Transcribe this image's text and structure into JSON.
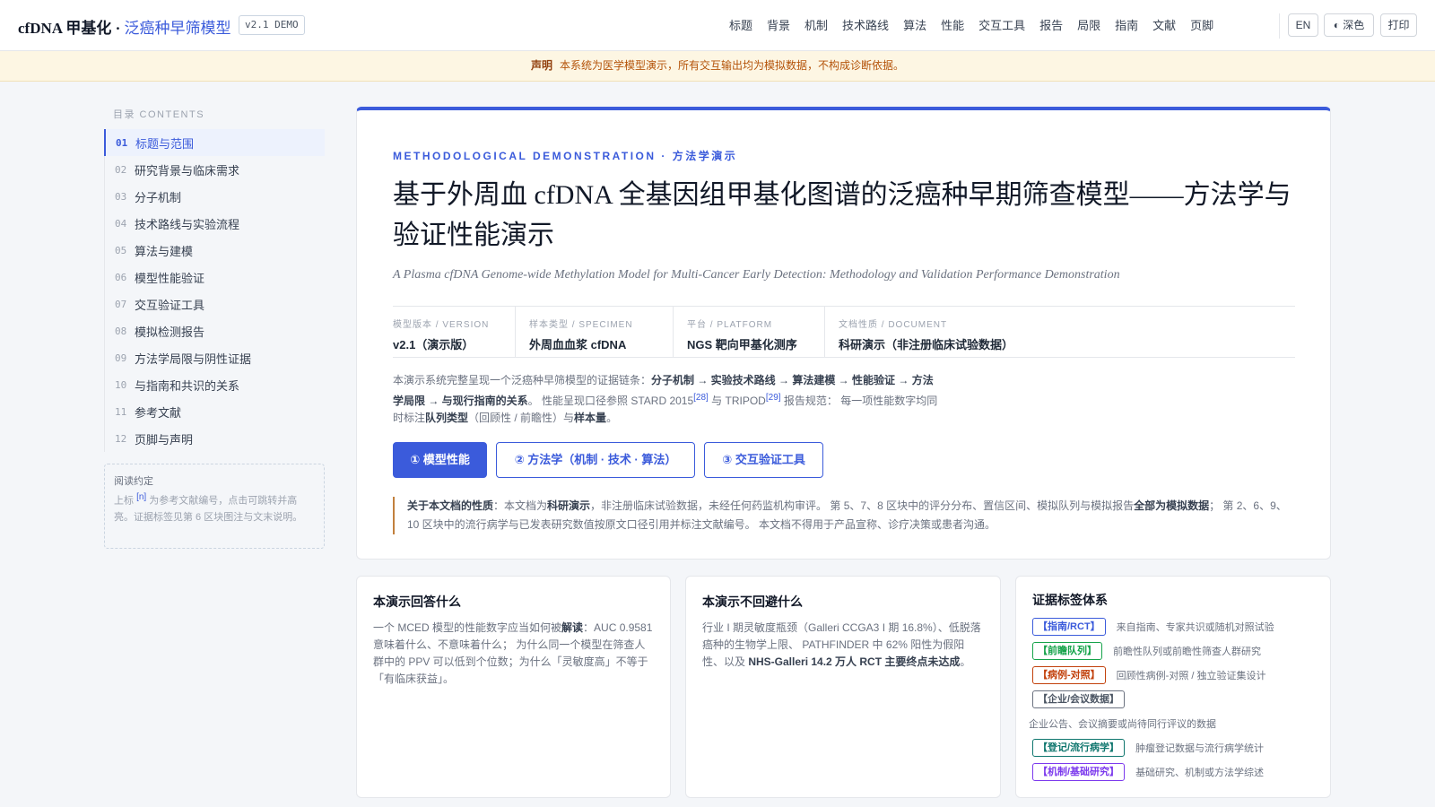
{
  "header": {
    "brand_main": "cfDNA 甲基化 · ",
    "brand_accent": "泛癌种早筛模型",
    "version_badge": "v2.1 DEMO",
    "nav": [
      "标题",
      "背景",
      "机制",
      "技术路线",
      "算法",
      "性能",
      "交互工具",
      "报告",
      "局限",
      "指南",
      "文献",
      "页脚"
    ],
    "lang_button": "EN",
    "theme_button": "深色",
    "print_button": "打印"
  },
  "notice": {
    "label": "声明",
    "text": "本系统为医学模型演示，所有交互输出均为模拟数据，不构成诊断依据。"
  },
  "sidebar": {
    "title": "目录 CONTENTS",
    "items": [
      {
        "num": "01",
        "label": "标题与范围"
      },
      {
        "num": "02",
        "label": "研究背景与临床需求"
      },
      {
        "num": "03",
        "label": "分子机制"
      },
      {
        "num": "04",
        "label": "技术路线与实验流程"
      },
      {
        "num": "05",
        "label": "算法与建模"
      },
      {
        "num": "06",
        "label": "模型性能验证"
      },
      {
        "num": "07",
        "label": "交互验证工具"
      },
      {
        "num": "08",
        "label": "模拟检测报告"
      },
      {
        "num": "09",
        "label": "方法学局限与阴性证据"
      },
      {
        "num": "10",
        "label": "与指南和共识的关系"
      },
      {
        "num": "11",
        "label": "参考文献"
      },
      {
        "num": "12",
        "label": "页脚与声明"
      }
    ],
    "reading": {
      "heading": "阅读约定",
      "text_a": "上标",
      "marker": "[n]",
      "text_b": "为参考文献编号，点击可跳转并高亮。证据标签见第 6 区块图注与文末说明。"
    }
  },
  "main": {
    "eyebrow": "METHODOLOGICAL DEMONSTRATION · 方法学演示",
    "title": "基于外周血 cfDNA 全基因组甲基化图谱的泛癌种早期筛查模型——方法学与验证性能演示",
    "subtitle": "A Plasma cfDNA Genome-wide Methylation Model for Multi-Cancer Early Detection: Methodology and Validation Performance Demonstration",
    "meta": [
      {
        "label": "模型版本 / VERSION",
        "value": "v2.1（演示版）"
      },
      {
        "label": "样本类型 / SPECIMEN",
        "value": "外周血血浆 cfDNA"
      },
      {
        "label": "平台 / PLATFORM",
        "value": "NGS 靶向甲基化测序"
      },
      {
        "label": "文档性质 / DOCUMENT",
        "value": "科研演示（非注册临床试验数据）"
      }
    ],
    "intro": {
      "p1": "本演示系统完整呈现一个泛癌种早筛模型的证据链条：",
      "b1": "分子机制 → 实验技术路线 → 算法建模 → 性能验证 → 方法学局限 → 与现行指南的关系",
      "p2": "。 性能呈现口径参照 STARD 2015",
      "ref1": "[28]",
      "p3": " 与 TRIPOD",
      "ref2": "[29]",
      "p4": " 报告规范： 每一项性能数字均同时标注",
      "b2": "队列类型",
      "p5": "（回顾性 / 前瞻性）与",
      "b3": "样本量",
      "p6": "。"
    },
    "buttons": {
      "b1_icon": "①",
      "b1_label": "模型性能",
      "b2_icon": "②",
      "b2_label": "方法学（机制 · 技术 · 算法）",
      "b3_icon": "③",
      "b3_label": "交互验证工具"
    },
    "note": {
      "b1": "关于本文档的性质",
      "p1": "：本文档为",
      "b2": "科研演示",
      "p2": "，非注册临床试验数据，未经任何药监机构审评。 第 5、7、8 区块中的评分分布、置信区间、模拟队列与模拟报告",
      "b3": "全部为模拟数据",
      "p3": "； 第 2、6、9、10 区块中的流行病学与已发表研究数值按原文口径引用并标注文献编号。 本文档不得用于产品宣称、诊疗决策或患者沟通。"
    }
  },
  "cards": {
    "c1": {
      "title": "本演示回答什么",
      "p1": "一个 MCED 模型的性能数字应当如何被",
      "b1": "解读",
      "p2": "：AUC 0.9581 意味着什么、不意味着什么； 为什么同一个模型在筛查人群中的 PPV 可以低到个位数；为什么「灵敏度高」不等于「有临床获益」。"
    },
    "c2": {
      "title": "本演示不回避什么",
      "p1": "行业 I 期灵敏度瓶颈（Galleri CCGA3 I 期 16.8%）、低脱落癌种的生物学上限、 PATHFINDER 中 62% 阳性为假阳性、以及 ",
      "b1": "NHS-Galleri 14.2 万人 RCT 主要终点未达成",
      "p2": "。"
    },
    "c3": {
      "title": "证据标签体系",
      "tags": [
        {
          "tag": "【指南/RCT】",
          "desc": "来自指南、专家共识或随机对照试验",
          "color": "#3b5bdb"
        },
        {
          "tag": "【前瞻队列】",
          "desc": "前瞻性队列或前瞻性筛查人群研究",
          "color": "#16a34a"
        },
        {
          "tag": "【病例-对照】",
          "desc": "回顾性病例-对照 / 独立验证集设计",
          "color": "#c2410c"
        },
        {
          "tag": "【企业/会议数据】",
          "desc": "企业公告、会议摘要或尚待同行评议的数据",
          "color": "#4b5563"
        },
        {
          "tag": "【登记/流行病学】",
          "desc": "肿瘤登记数据与流行病学统计",
          "color": "#0f766e"
        },
        {
          "tag": "【机制/基础研究】",
          "desc": "基础研究、机制或方法学综述",
          "color": "#7c3aed"
        }
      ]
    }
  }
}
